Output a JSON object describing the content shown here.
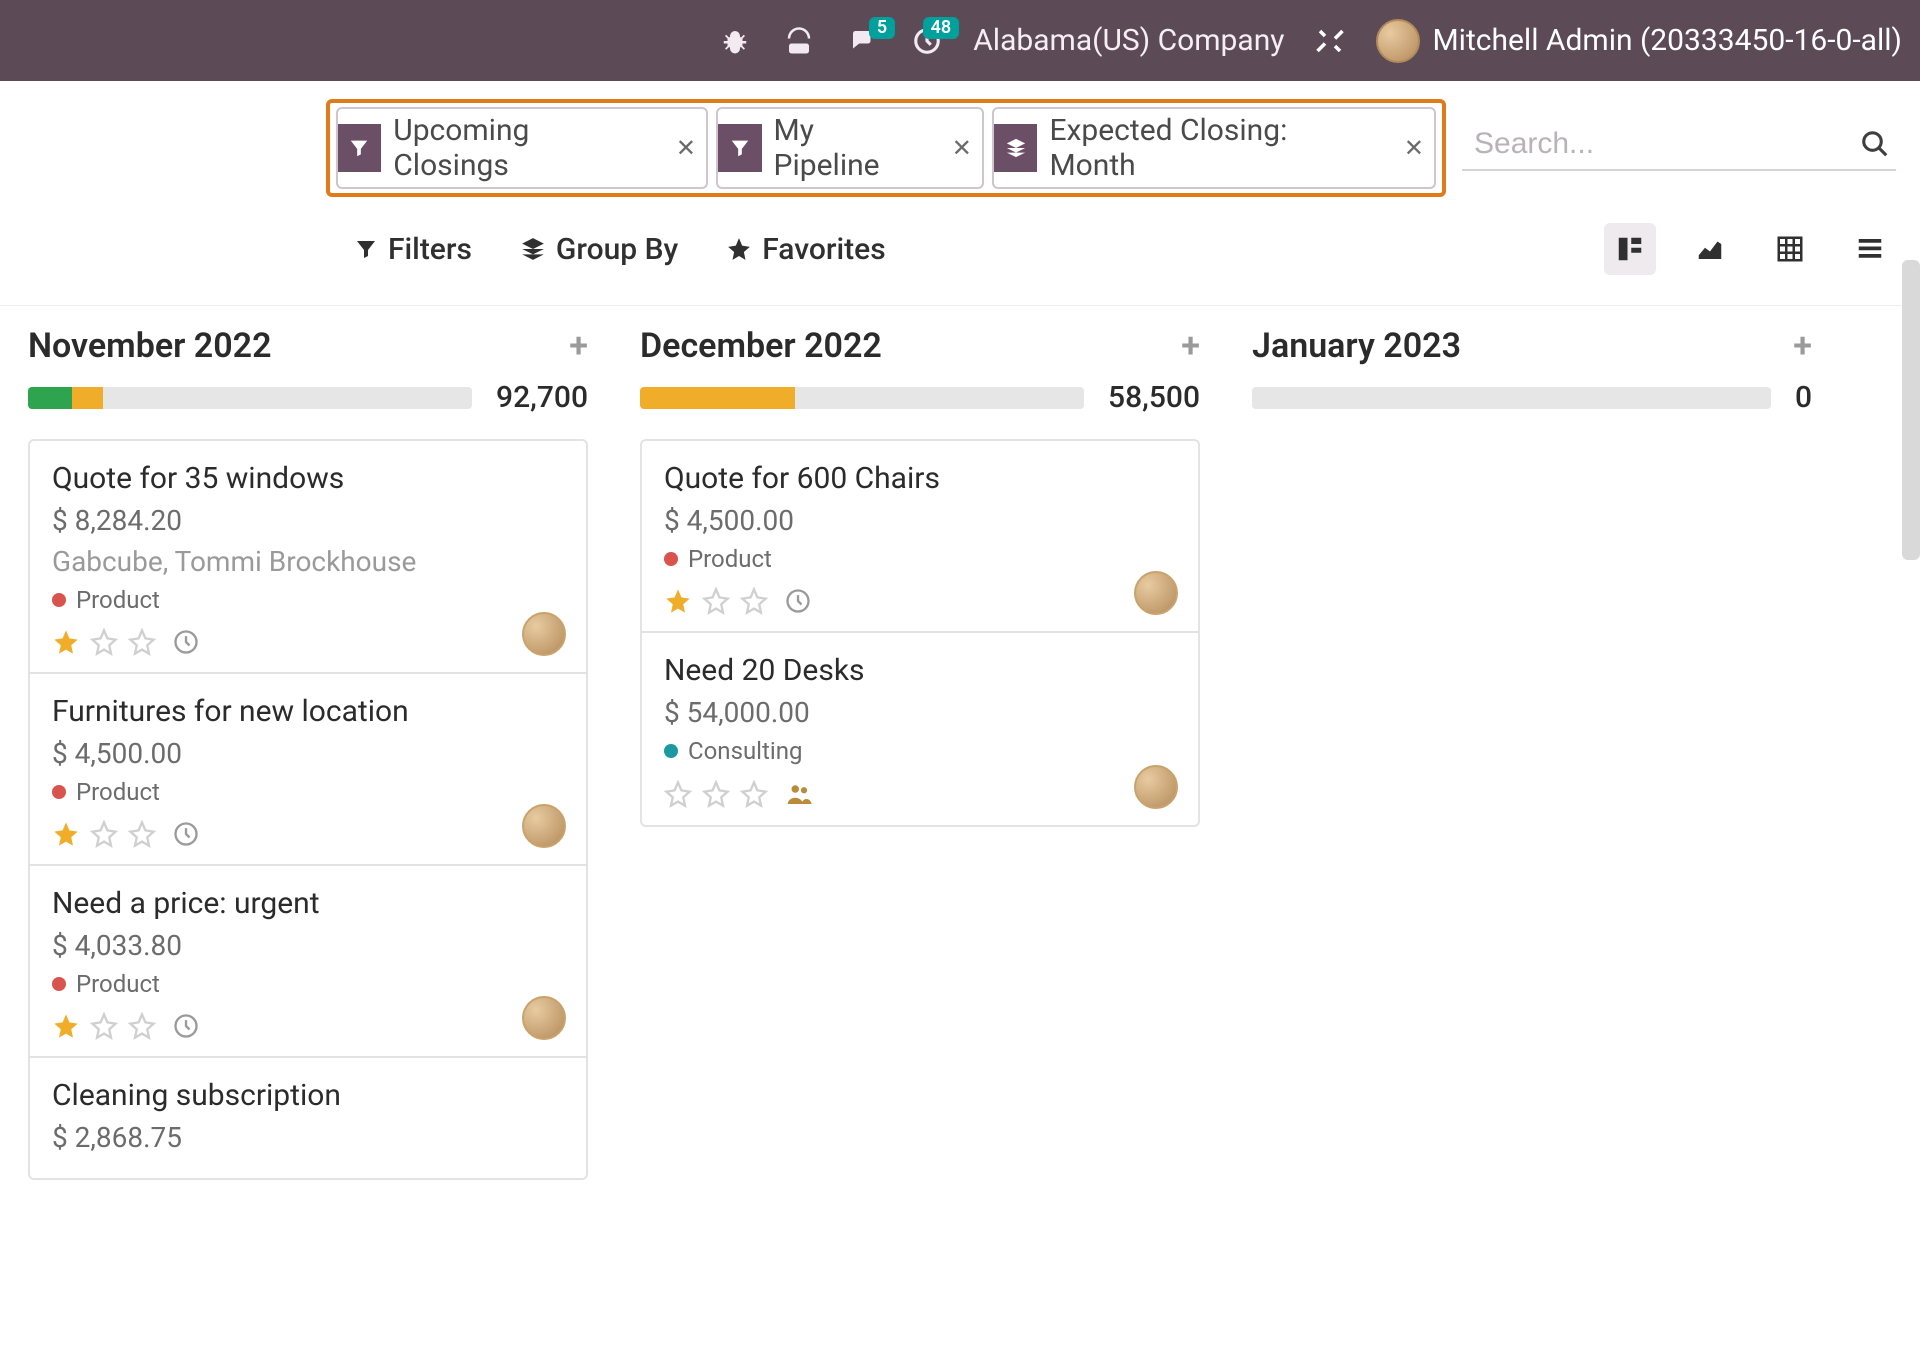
{
  "topbar": {
    "badges": {
      "messages": "5",
      "activities": "48"
    },
    "company": "Alabama(US) Company",
    "user": "Mitchell Admin (20333450-16-0-all)"
  },
  "filters": {
    "chips": [
      {
        "icon": "filter",
        "label": "Upcoming Closings"
      },
      {
        "icon": "filter",
        "label": "My Pipeline"
      },
      {
        "icon": "group",
        "label": "Expected Closing: Month"
      }
    ],
    "search_placeholder": "Search..."
  },
  "controls": {
    "filters": "Filters",
    "groupby": "Group By",
    "favorites": "Favorites"
  },
  "columns": [
    {
      "title": "November 2022",
      "total": "92,700",
      "bar": {
        "green": 10,
        "orange": 7
      },
      "cards": [
        {
          "title": "Quote for 35 windows",
          "amount": "$ 8,284.20",
          "sub": "Gabcube, Tommi Brockhouse",
          "tag": "Product",
          "tag_color": "red",
          "stars": 1,
          "clock": true,
          "avatar": true
        },
        {
          "title": "Furnitures for new location",
          "amount": "$ 4,500.00",
          "sub": "",
          "tag": "Product",
          "tag_color": "red",
          "stars": 1,
          "clock": true,
          "avatar": true
        },
        {
          "title": "Need a price: urgent",
          "amount": "$ 4,033.80",
          "sub": "",
          "tag": "Product",
          "tag_color": "red",
          "stars": 1,
          "clock": true,
          "avatar": true
        },
        {
          "title": "Cleaning subscription",
          "amount": "$ 2,868.75",
          "sub": "",
          "tag": "",
          "tag_color": "",
          "stars": 0,
          "clock": false,
          "avatar": false
        }
      ]
    },
    {
      "title": "December 2022",
      "total": "58,500",
      "bar": {
        "green": 0,
        "orange": 35
      },
      "cards": [
        {
          "title": "Quote for 600 Chairs",
          "amount": "$ 4,500.00",
          "sub": "",
          "tag": "Product",
          "tag_color": "red",
          "stars": 1,
          "clock": true,
          "avatar": true
        },
        {
          "title": "Need 20 Desks",
          "amount": "$ 54,000.00",
          "sub": "",
          "tag": "Consulting",
          "tag_color": "teal",
          "stars": 0,
          "clock": false,
          "group": true,
          "avatar": true
        }
      ]
    },
    {
      "title": "January 2023",
      "total": "0",
      "bar": {
        "green": 0,
        "orange": 0
      },
      "cards": []
    }
  ]
}
